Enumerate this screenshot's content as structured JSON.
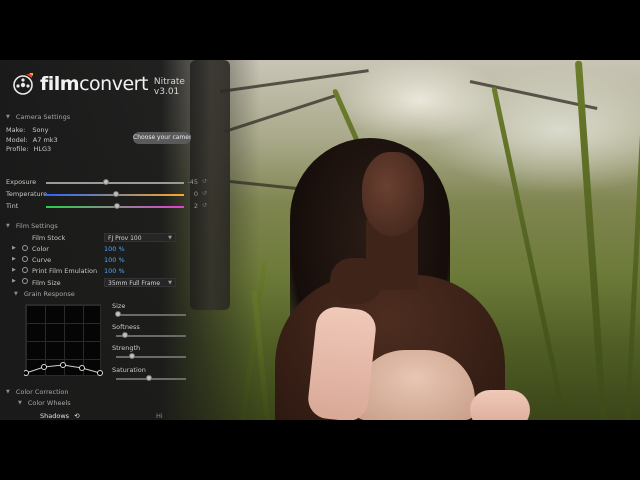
{
  "app": {
    "logo_text_bold": "film",
    "logo_text_light": "convert",
    "version": "Nitrate v3.01"
  },
  "camera_settings": {
    "section_label": "Camera Settings",
    "make_label": "Make:",
    "make_value": "Sony",
    "model_label": "Model:",
    "model_value": "A7 mk3",
    "profile_label": "Profile:",
    "profile_value": "HLG3",
    "choose_button": "Choose your camera"
  },
  "adjustments": {
    "exposure_label": "Exposure",
    "exposure_value": "-45",
    "temperature_label": "Temperature",
    "temperature_value": "0",
    "tint_label": "Tint",
    "tint_value": "2"
  },
  "film_settings": {
    "section_label": "Film Settings",
    "film_stock_label": "Film Stock",
    "film_stock_value": "FJ Prov 100",
    "color_label": "Color",
    "color_value": "100 %",
    "curve_label": "Curve",
    "curve_value": "100 %",
    "print_label": "Print Film Emulation",
    "print_value": "100 %",
    "film_size_label": "Film Size",
    "film_size_value": "35mm Full Frame"
  },
  "grain": {
    "section_label": "Grain Response",
    "size_label": "Size",
    "softness_label": "Softness",
    "strength_label": "Strength",
    "saturation_label": "Saturation"
  },
  "color_correction": {
    "section_label": "Color Correction",
    "wheels_label": "Color Wheels",
    "shadows_label": "Shadows",
    "hi_label": "Hi"
  },
  "colors": {
    "accent_blue": "#4fa3ff",
    "panel_bg": "#1a1a1a"
  }
}
